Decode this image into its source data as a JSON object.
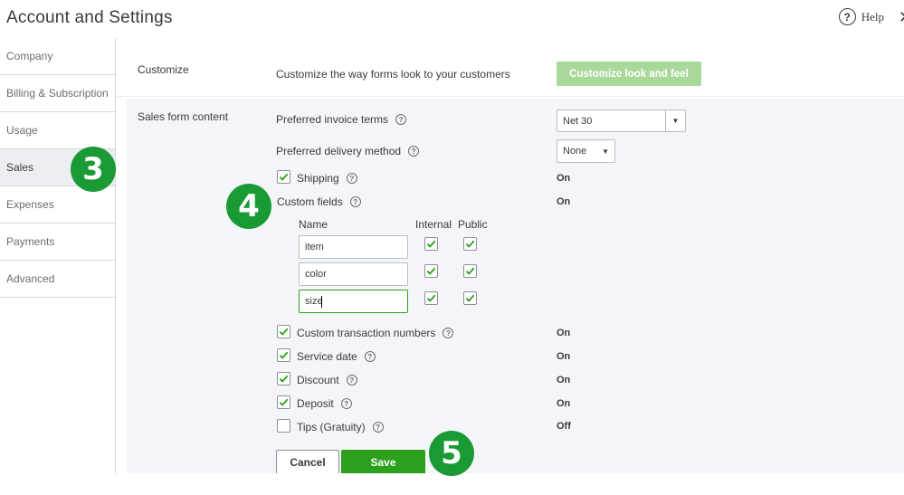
{
  "header": {
    "title": "Account and Settings",
    "help_label": "Help"
  },
  "sidebar": {
    "items": [
      {
        "label": "Company"
      },
      {
        "label": "Billing & Subscription"
      },
      {
        "label": "Usage"
      },
      {
        "label": "Sales",
        "active": true
      },
      {
        "label": "Expenses"
      },
      {
        "label": "Payments"
      },
      {
        "label": "Advanced"
      }
    ]
  },
  "customize": {
    "section_label": "Customize",
    "description": "Customize the way forms look to your customers",
    "button_label": "Customize look and feel"
  },
  "sales_form": {
    "section_label": "Sales form content",
    "invoice_terms": {
      "label": "Preferred invoice terms",
      "value": "Net 30"
    },
    "delivery_method": {
      "label": "Preferred delivery method",
      "value": "None"
    },
    "shipping": {
      "label": "Shipping",
      "checked": true,
      "status": "On"
    },
    "custom_fields": {
      "label": "Custom fields",
      "status": "On",
      "col_name": "Name",
      "col_internal": "Internal",
      "col_public": "Public",
      "rows": [
        {
          "name": "item",
          "internal": true,
          "public": true
        },
        {
          "name": "color",
          "internal": true,
          "public": true
        },
        {
          "name": "size",
          "internal": true,
          "public": true
        }
      ]
    },
    "options": [
      {
        "label": "Custom transaction numbers",
        "checked": true,
        "status": "On"
      },
      {
        "label": "Service date",
        "checked": true,
        "status": "On"
      },
      {
        "label": "Discount",
        "checked": true,
        "status": "On"
      },
      {
        "label": "Deposit",
        "checked": true,
        "status": "On"
      },
      {
        "label": "Tips (Gratuity)",
        "checked": false,
        "status": "Off"
      }
    ],
    "cancel_label": "Cancel",
    "save_label": "Save"
  },
  "annotations": {
    "step3": "3",
    "step4": "4",
    "step5": "5"
  },
  "colors": {
    "accent": "#2ca01c",
    "badge": "#1a9a34",
    "disabled_button": "#a9d99a",
    "panel_bg": "#f4f5f8"
  }
}
